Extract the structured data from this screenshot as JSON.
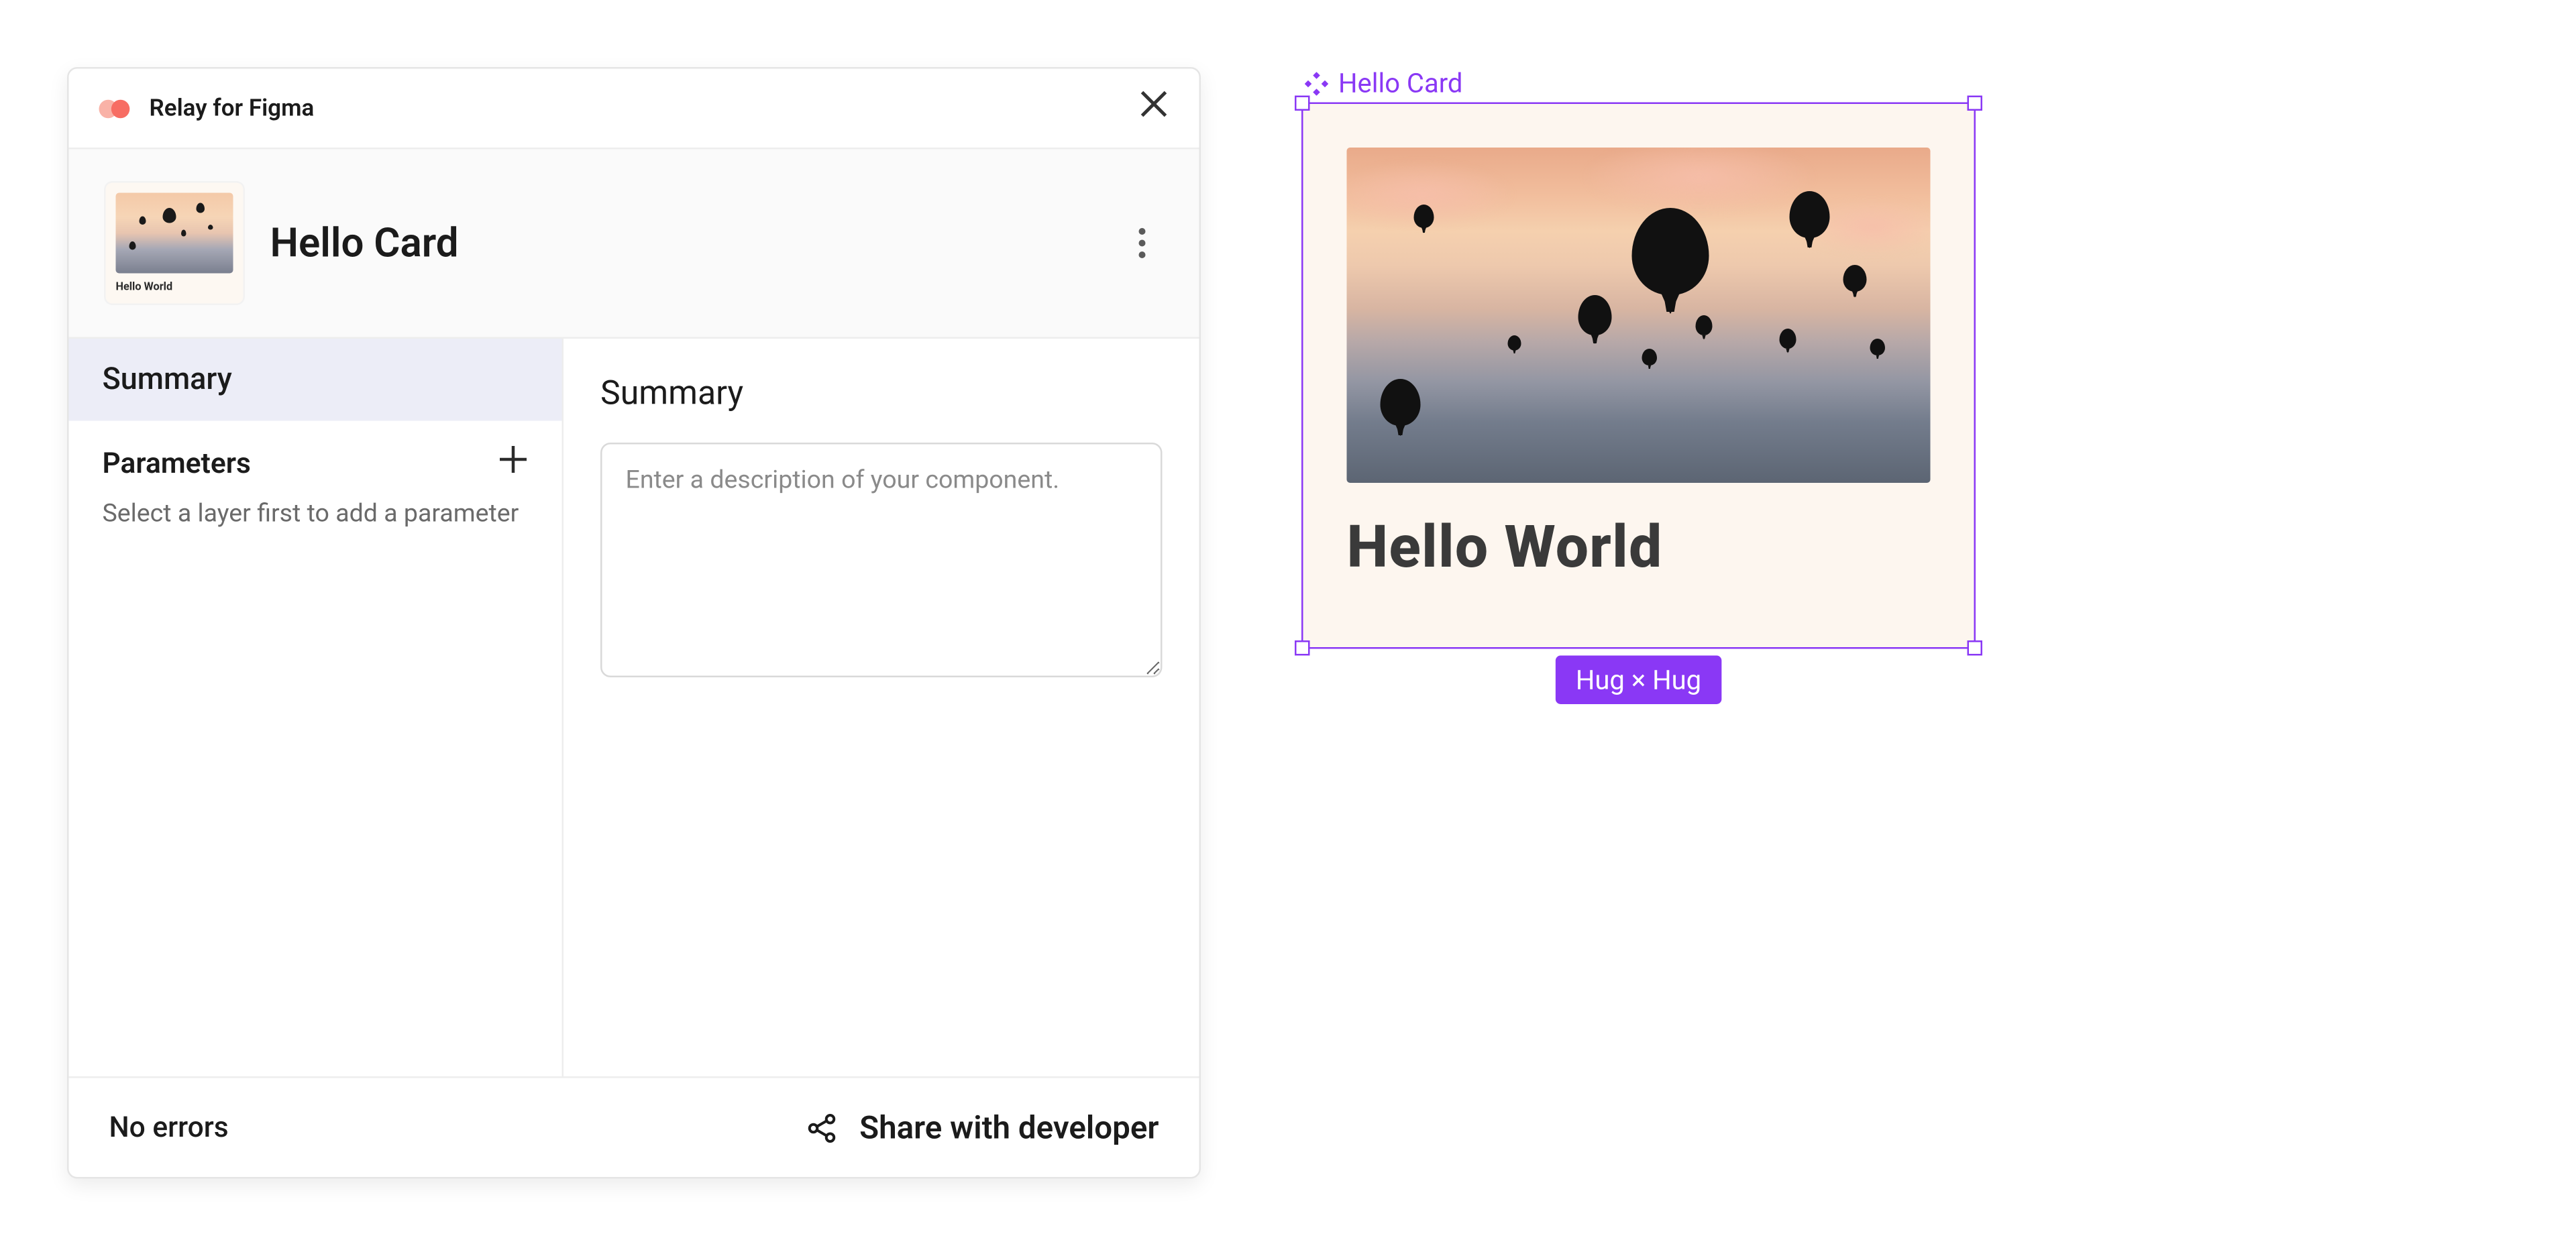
{
  "panel": {
    "titlebar_label": "Relay for Figma",
    "component_title": "Hello Card",
    "thumb_caption": "Hello World",
    "sidebar": {
      "tab_summary": "Summary",
      "parameters_label": "Parameters",
      "parameters_help": "Select a layer first to add a parameter"
    },
    "main": {
      "heading": "Summary",
      "description_placeholder": "Enter a description of your component."
    },
    "footer": {
      "status": "No errors",
      "share_label": "Share with developer"
    }
  },
  "canvas": {
    "frame_label": "Hello Card",
    "card_text": "Hello World",
    "size_badge": "Hug × Hug"
  },
  "colors": {
    "figma_purple": "#8a38f5",
    "relay_coral": "#f76d63"
  }
}
